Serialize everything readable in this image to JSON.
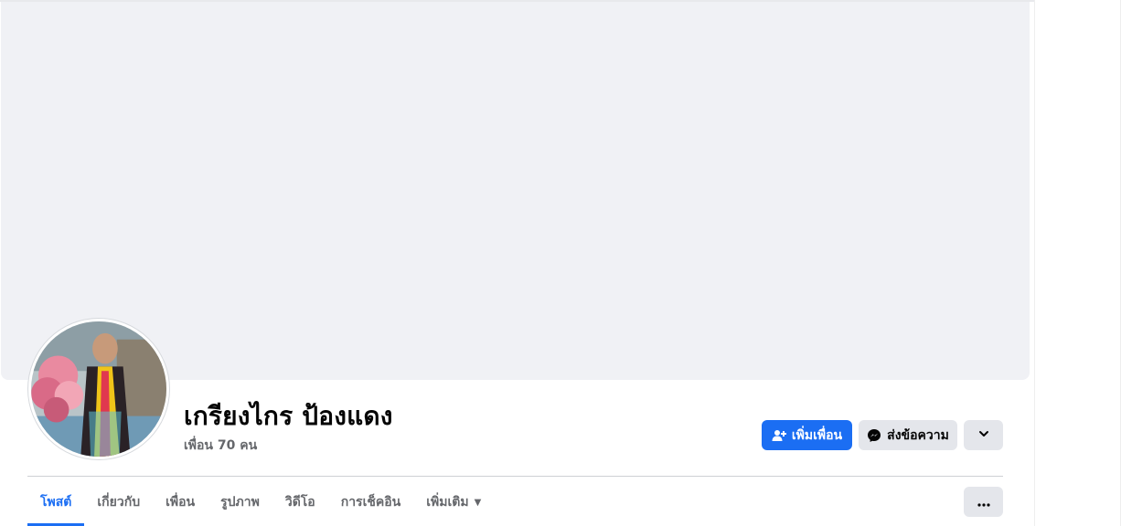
{
  "profile": {
    "name": "เกรียงไกร ป้องแดง",
    "friends_count": "เพื่อน 70 คน"
  },
  "actions": {
    "add_friend_label": "เพิ่มเพื่อน",
    "message_label": "ส่งข้อความ"
  },
  "tabs": [
    {
      "label": "โพสต์",
      "active": true
    },
    {
      "label": "เกี่ยวกับ",
      "active": false
    },
    {
      "label": "เพื่อน",
      "active": false
    },
    {
      "label": "รูปภาพ",
      "active": false
    },
    {
      "label": "วิดีโอ",
      "active": false
    },
    {
      "label": "การเช็คอิน",
      "active": false
    },
    {
      "label": "เพิ่มเติม",
      "active": false
    }
  ],
  "colors": {
    "accent": "#1b6ef3",
    "cover": "#f0f1f5",
    "secondary_button": "#e4e6eb",
    "muted_text": "#65676b"
  },
  "icons": {
    "add_friend": "person-add-icon",
    "message": "messenger-icon",
    "dropdown": "chevron-down-icon",
    "tabs_more": "more-dots-icon",
    "tab_more_caret": "caret-down-icon"
  }
}
